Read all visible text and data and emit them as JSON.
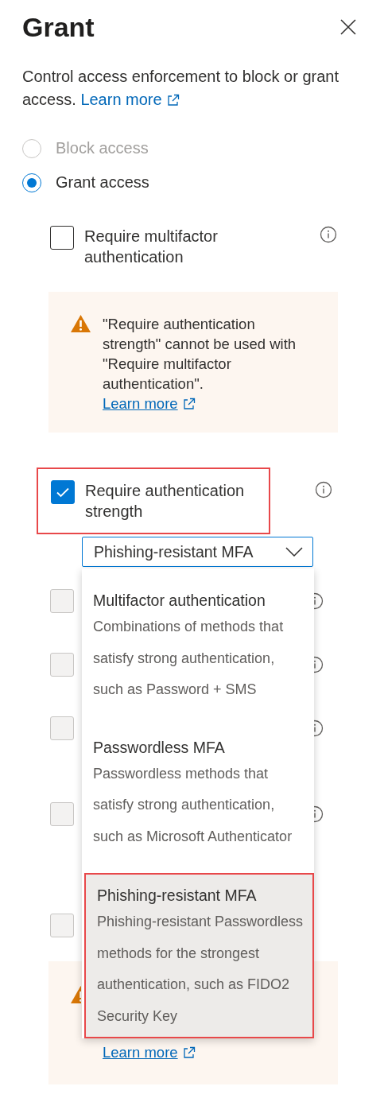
{
  "title": "Grant",
  "description": "Control access enforcement to block or grant access.",
  "description_link": "Learn more",
  "radios": [
    {
      "label": "Block access",
      "selected": false,
      "disabled": true
    },
    {
      "label": "Grant access",
      "selected": true,
      "disabled": false
    }
  ],
  "mfa_option": {
    "label": "Require multifactor authentication",
    "checked": false
  },
  "warning": {
    "text": "\"Require authentication strength\" cannot be used with \"Require multifactor authentication\".",
    "link": "Learn more"
  },
  "strength_option": {
    "label": "Require authentication strength",
    "checked": true,
    "highlighted": true
  },
  "strength_dropdown": {
    "value": "Phishing-resistant MFA",
    "expanded": true,
    "options": [
      {
        "title": "Multifactor authentication",
        "description": "Combinations of methods that satisfy strong authentication, such as Password + SMS",
        "selected": false,
        "highlighted": false
      },
      {
        "title": "Passwordless MFA",
        "description": "Passwordless methods that satisfy strong authentication, such as Microsoft Authenticator",
        "selected": false,
        "highlighted": false
      },
      {
        "title": "Phishing-resistant MFA",
        "description": "Phishing-resistant Passwordless methods for the strongest authentication, such as FIDO2 Security Key",
        "selected": true,
        "highlighted": true
      }
    ]
  },
  "obscured_options": [
    {
      "checked": false,
      "disabled": true
    },
    {
      "checked": false,
      "disabled": true
    },
    {
      "checked": false,
      "disabled": true
    },
    {
      "checked": false,
      "disabled": true
    },
    {
      "checked": false,
      "disabled": true
    }
  ],
  "bottom_warning": {
    "link": "Learn more"
  }
}
